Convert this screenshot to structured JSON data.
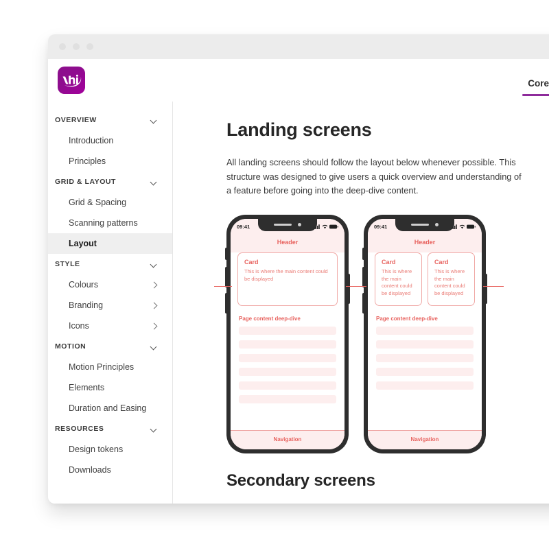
{
  "window": {
    "traffic_lights": [
      "close",
      "minimize",
      "maximize"
    ]
  },
  "header": {
    "logo_text": "Vhi",
    "logo_color": "#8e0d8e",
    "accent_color": "#8e2b9b",
    "tabs": [
      {
        "label": "Core",
        "active": true
      }
    ]
  },
  "sidebar": {
    "groups": [
      {
        "label": "OVERVIEW",
        "chevron": "chevron-down-icon",
        "items": [
          {
            "label": "Introduction",
            "active": false,
            "chevron": ""
          },
          {
            "label": "Principles",
            "active": false,
            "chevron": ""
          }
        ]
      },
      {
        "label": "GRID & LAYOUT",
        "chevron": "chevron-down-icon",
        "items": [
          {
            "label": "Grid & Spacing",
            "active": false,
            "chevron": ""
          },
          {
            "label": "Scanning patterns",
            "active": false,
            "chevron": ""
          },
          {
            "label": "Layout",
            "active": true,
            "chevron": ""
          }
        ]
      },
      {
        "label": "STYLE",
        "chevron": "chevron-down-icon",
        "items": [
          {
            "label": "Colours",
            "active": false,
            "chevron": "chevron-right-icon"
          },
          {
            "label": "Branding",
            "active": false,
            "chevron": "chevron-right-icon"
          },
          {
            "label": "Icons",
            "active": false,
            "chevron": "chevron-right-icon"
          }
        ]
      },
      {
        "label": "MOTION",
        "chevron": "chevron-down-icon",
        "items": [
          {
            "label": "Motion Principles",
            "active": false,
            "chevron": ""
          },
          {
            "label": "Elements",
            "active": false,
            "chevron": ""
          },
          {
            "label": "Duration and Easing",
            "active": false,
            "chevron": ""
          }
        ]
      },
      {
        "label": "RESOURCES",
        "chevron": "chevron-down-icon",
        "items": [
          {
            "label": "Design tokens",
            "active": false,
            "chevron": ""
          },
          {
            "label": "Downloads",
            "active": false,
            "chevron": ""
          }
        ]
      }
    ]
  },
  "main": {
    "page_title": "Landing screens",
    "intro_paragraph": "All landing screens should follow the layout below whenever possible. This structure was designed to give users a quick overview and understanding of a feature before going into the deep-dive content.",
    "secondary_title": "Secondary screens",
    "phones": [
      {
        "id": "phone-single-card",
        "status_time": "09:41",
        "status_icons": [
          "signal-icon",
          "wifi-icon",
          "battery-icon"
        ],
        "header_label": "Header",
        "cards": [
          {
            "title": "Card",
            "text": "This is where the main content could be displayed"
          }
        ],
        "deep_dive_label": "Page content deep-dive",
        "content_row_count": 6,
        "nav_label": "Navigation"
      },
      {
        "id": "phone-two-cards",
        "status_time": "09:41",
        "status_icons": [
          "signal-icon",
          "wifi-icon",
          "battery-icon"
        ],
        "header_label": "Header",
        "cards": [
          {
            "title": "Card",
            "text": "This is where the main content could be displayed"
          },
          {
            "title": "Card",
            "text": "This is where the main content could be displayed"
          }
        ],
        "deep_dive_label": "Page content deep-dive",
        "content_row_count": 5,
        "nav_label": "Navigation"
      }
    ],
    "phone_accent_color": "#e8635f",
    "phone_tint_color": "#fdeeee"
  }
}
